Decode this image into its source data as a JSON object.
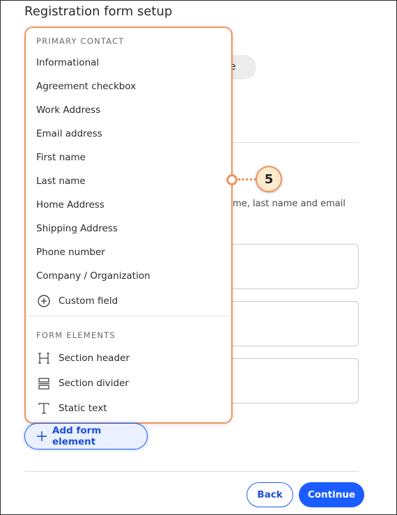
{
  "page": {
    "title": "Registration form setup"
  },
  "background": {
    "pill_text": "e",
    "helper_text": "me, last name and email"
  },
  "dropdown": {
    "primary_group": "PRIMARY CONTACT",
    "primary_items": [
      "Informational",
      "Agreement checkbox",
      "Work Address",
      "Email address",
      "First name",
      "Last name",
      "Home Address",
      "Shipping Address",
      "Phone number",
      "Company / Organization"
    ],
    "custom_field": "Custom field",
    "elements_group": "FORM ELEMENTS",
    "element_items": [
      {
        "label": "Section header",
        "icon": "heading-icon"
      },
      {
        "label": "Section divider",
        "icon": "divider-icon"
      },
      {
        "label": "Static text",
        "icon": "text-icon"
      }
    ]
  },
  "callout": {
    "number": "5",
    "color": "#f0925a"
  },
  "actions": {
    "add_label": "Add form element",
    "back_label": "Back",
    "continue_label": "Continue",
    "accent": "#1a5cff"
  }
}
